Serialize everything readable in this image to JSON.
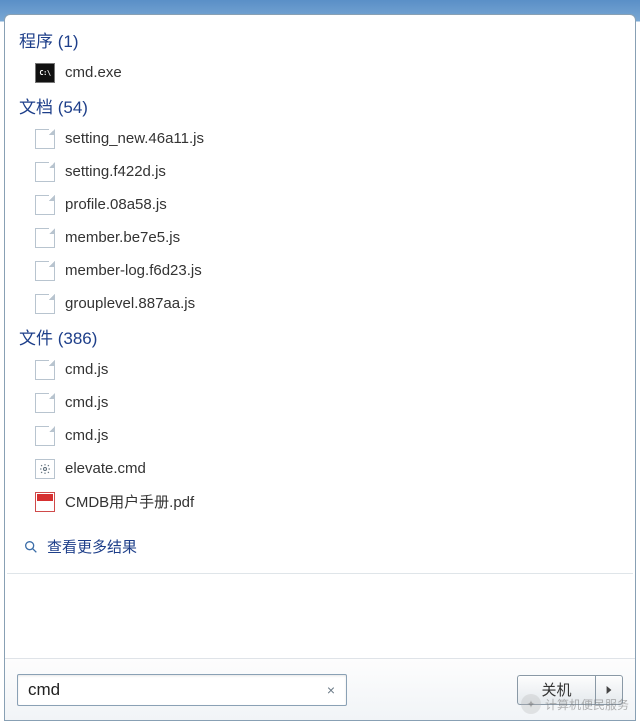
{
  "groups": [
    {
      "label": "程序",
      "count": "(1)",
      "items": [
        {
          "icon": "cmd",
          "name": "cmd.exe"
        }
      ]
    },
    {
      "label": "文档",
      "count": "(54)",
      "items": [
        {
          "icon": "file",
          "name": "setting_new.46a11.js"
        },
        {
          "icon": "file",
          "name": "setting.f422d.js"
        },
        {
          "icon": "file",
          "name": "profile.08a58.js"
        },
        {
          "icon": "file",
          "name": "member.be7e5.js"
        },
        {
          "icon": "file",
          "name": "member-log.f6d23.js"
        },
        {
          "icon": "file",
          "name": "grouplevel.887aa.js"
        }
      ]
    },
    {
      "label": "文件",
      "count": "(386)",
      "items": [
        {
          "icon": "file",
          "name": "cmd.js"
        },
        {
          "icon": "file",
          "name": "cmd.js"
        },
        {
          "icon": "file",
          "name": "cmd.js"
        },
        {
          "icon": "gear",
          "name": "elevate.cmd"
        },
        {
          "icon": "pdf",
          "name": "CMDB用户手册.pdf"
        }
      ]
    }
  ],
  "more_results_label": "查看更多结果",
  "search": {
    "value": "cmd",
    "clear_glyph": "×"
  },
  "shutdown_label": "关机",
  "arrow_glyph": "▶",
  "watermark_text": "计算机便民服务"
}
